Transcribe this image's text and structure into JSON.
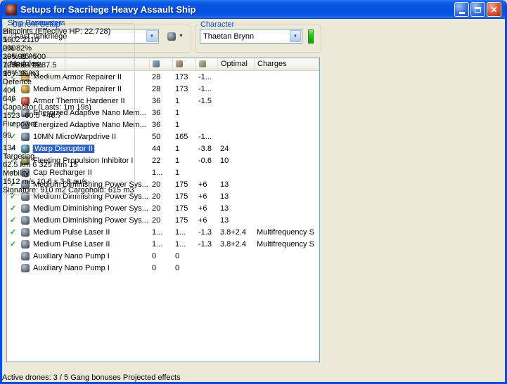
{
  "window": {
    "title": "Setups for Sacrilege Heavy Assault Ship"
  },
  "current_setup": {
    "label": "Current Setup",
    "value": "Fast Tankrilege"
  },
  "character": {
    "label": "Character",
    "value": "Thaetan Brynn"
  },
  "modules": {
    "columns": {
      "name": "Modules",
      "optimal": "Optimal",
      "charges": "Charges"
    },
    "rows": [
      {
        "check": "ok",
        "icon": "repairer",
        "name": "Medium Armor Repairer II",
        "cpu": "28",
        "pg": "173",
        "cap": "-1...",
        "optimal": "",
        "charge": "",
        "selected": false
      },
      {
        "check": "ok",
        "icon": "repairer",
        "name": "Medium Armor Repairer II",
        "cpu": "28",
        "pg": "173",
        "cap": "-1...",
        "optimal": "",
        "charge": "",
        "selected": false
      },
      {
        "check": "ok",
        "icon": "hardener",
        "name": "Armor Thermic Hardener II",
        "cpu": "36",
        "pg": "1",
        "cap": "-1.5",
        "optimal": "",
        "charge": "",
        "selected": false
      },
      {
        "check": "ok",
        "icon": "membrane",
        "name": "Energized Adaptive Nano Mem...",
        "cpu": "36",
        "pg": "1",
        "cap": "",
        "optimal": "",
        "charge": "",
        "selected": false
      },
      {
        "check": "ok",
        "icon": "membrane",
        "name": "Energized Adaptive Nano Mem...",
        "cpu": "36",
        "pg": "1",
        "cap": "",
        "optimal": "",
        "charge": "",
        "selected": false
      },
      {
        "check": "ok",
        "icon": "mwd",
        "name": "10MN MicroWarpdrive II",
        "cpu": "50",
        "pg": "165",
        "cap": "-1...",
        "optimal": "",
        "charge": "",
        "selected": false
      },
      {
        "check": "active",
        "icon": "disruptor",
        "name": "Warp Disruptor II",
        "cpu": "44",
        "pg": "1",
        "cap": "-3.8",
        "optimal": "24",
        "charge": "",
        "selected": true
      },
      {
        "check": "ok",
        "icon": "web",
        "name": "Fleeting Propulsion Inhibitor I",
        "cpu": "22",
        "pg": "1",
        "cap": "-0.6",
        "optimal": "10",
        "charge": "",
        "selected": false
      },
      {
        "check": "ok",
        "icon": "capre",
        "name": "Cap Recharger II",
        "cpu": "1...",
        "pg": "1",
        "cap": "",
        "optimal": "",
        "charge": "",
        "selected": false
      },
      {
        "check": "ok",
        "icon": "heatsink",
        "name": "Medium Diminishing Power Sys...",
        "cpu": "20",
        "pg": "175",
        "cap": "+6",
        "optimal": "13",
        "charge": "",
        "selected": false
      },
      {
        "check": "ok",
        "icon": "heatsink",
        "name": "Medium Diminishing Power Sys...",
        "cpu": "20",
        "pg": "175",
        "cap": "+6",
        "optimal": "13",
        "charge": "",
        "selected": false
      },
      {
        "check": "ok",
        "icon": "heatsink",
        "name": "Medium Diminishing Power Sys...",
        "cpu": "20",
        "pg": "175",
        "cap": "+6",
        "optimal": "13",
        "charge": "",
        "selected": false
      },
      {
        "check": "ok",
        "icon": "heatsink",
        "name": "Medium Diminishing Power Sys...",
        "cpu": "20",
        "pg": "175",
        "cap": "+6",
        "optimal": "13",
        "charge": "",
        "selected": false
      },
      {
        "check": "ok",
        "icon": "laser",
        "name": "Medium Pulse Laser II",
        "cpu": "1...",
        "pg": "1...",
        "cap": "-1.3",
        "optimal": "3.8+2.4",
        "charge": "Multifrequency S",
        "selected": false
      },
      {
        "check": "ok",
        "icon": "laser",
        "name": "Medium Pulse Laser II",
        "cpu": "1...",
        "pg": "1...",
        "cap": "-1.3",
        "optimal": "3.8+2.4",
        "charge": "Multifrequency S",
        "selected": false
      },
      {
        "check": "none",
        "icon": "rig",
        "name": "Auxiliary Nano Pump I",
        "cpu": "0",
        "pg": "0",
        "cap": "",
        "optimal": "",
        "charge": "",
        "selected": false
      },
      {
        "check": "none",
        "icon": "rig",
        "name": "Auxiliary Nano Pump I",
        "cpu": "0",
        "pg": "0",
        "cap": "",
        "optimal": "",
        "charge": "",
        "selected": false
      }
    ]
  },
  "ship_resources": {
    "label": "Ship Resources",
    "turrets": "2",
    "launchers": "5",
    "calibration": "200",
    "bars": [
      {
        "name": "cpu",
        "text": "395.98 / 500",
        "pct": 79
      },
      {
        "name": "powergrid",
        "text": "1238.6 / 1287.5",
        "pct": 96
      },
      {
        "name": "dronebay",
        "text": "15 / 15 m3",
        "pct": 100
      }
    ]
  },
  "ship_parameters": {
    "label": "Ship Parameters",
    "hitpoints": {
      "title": "Hitpoints (Effective HP: 22,728)",
      "shield_hp": "1602",
      "armor_hp": "2110",
      "resists": [
        {
          "type": "em",
          "shield": "0%",
          "armor": "82%"
        },
        {
          "type": "thermal",
          "shield": "20%",
          "armor": "85%"
        },
        {
          "type": "kinetic",
          "shield": "70%",
          "armor": "83.1%"
        },
        {
          "type": "explosive",
          "shield": "90%",
          "armor": "91%"
        }
      ]
    },
    "defence": {
      "title": "Defence",
      "value1": "404",
      "value2": "646"
    },
    "capacitor": {
      "title": "Capacitor (Lasts: 1m 19s)",
      "amount": "1523",
      "usage": "-60.5",
      "recharge": "+46.7"
    },
    "firepower": {
      "title": "Firepower",
      "value1": "99",
      "value2": "134"
    },
    "targeting": {
      "title": "Targeting",
      "range": "62.5 km",
      "max_targets": "6",
      "scan_resolution": "325 mm",
      "sensor_strength": "15"
    },
    "mobility": {
      "title": "Mobility",
      "speed": "1512 m/s",
      "align_time": "10.6 s",
      "warp_speed": "3.8 au/s"
    },
    "signature": "Signature: 910 m2",
    "cargohold": "Cargohold: 615 m3"
  },
  "statusbar": {
    "active_drones": "Active drones: 3 / 5",
    "gang_bonuses": "Gang bonuses",
    "projected_effects": "Projected effects"
  }
}
